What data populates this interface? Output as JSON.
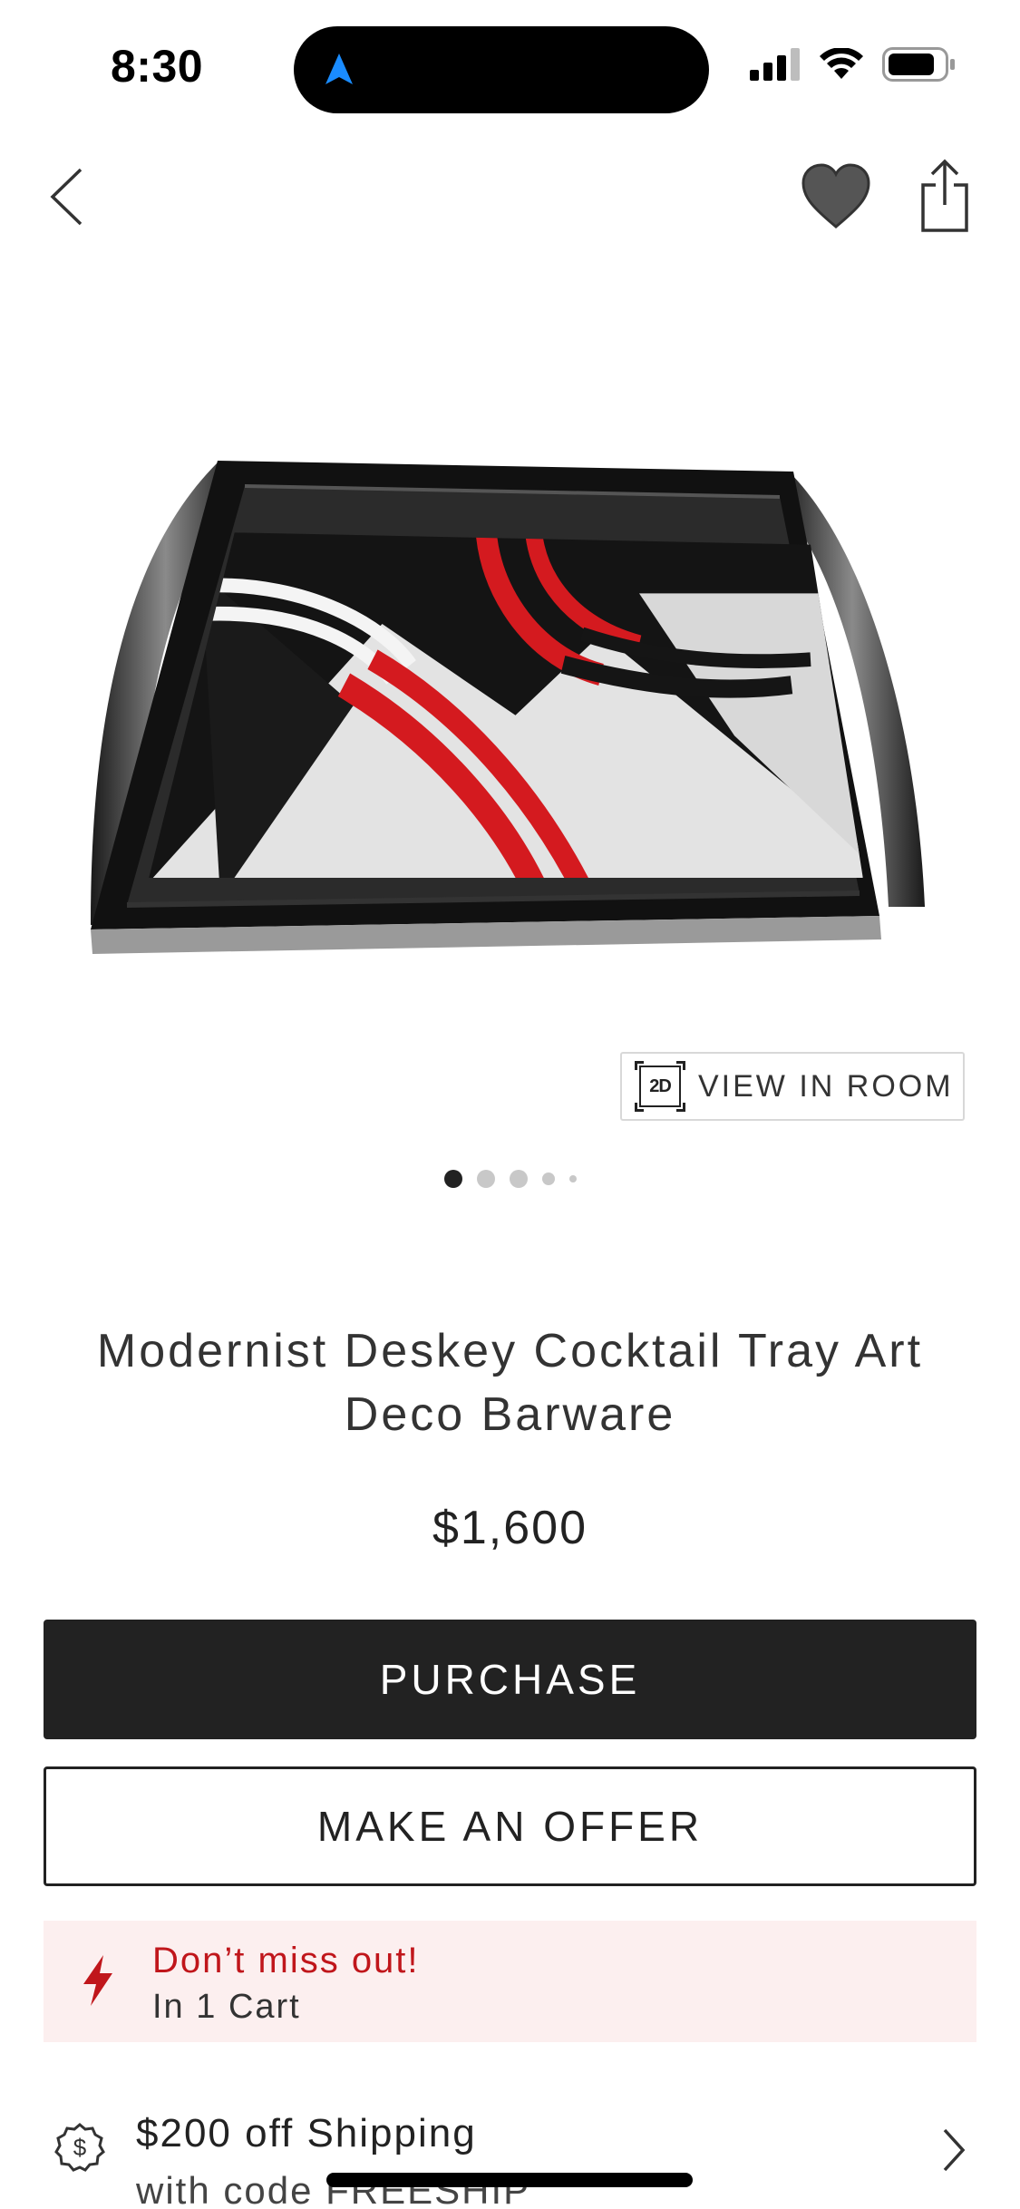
{
  "status_bar": {
    "time": "8:30"
  },
  "product": {
    "title": "Modernist Deskey Cocktail Tray Art Deco Barware",
    "price": "$1,600",
    "image_alt": "Art deco cocktail tray with black, white and red geometric design"
  },
  "view_in_room": {
    "badge": "2D",
    "label": "VIEW IN ROOM"
  },
  "carousel": {
    "total_dots": 5,
    "active_index": 0
  },
  "actions": {
    "purchase_label": "PURCHASE",
    "offer_label": "MAKE AN OFFER"
  },
  "alert": {
    "title": "Don’t miss out!",
    "subtitle": "In 1 Cart"
  },
  "promo": {
    "title": "$200 off Shipping",
    "subtitle": "with code FREESHIP"
  },
  "colors": {
    "accent_red": "#c0161b",
    "alert_bg": "#fcefef",
    "button_dark": "#222222",
    "location_blue": "#1a8cff"
  },
  "icons": {
    "back": "chevron-left-icon",
    "favorite": "heart-icon",
    "share": "share-icon",
    "alert": "lightning-icon",
    "promo": "dollar-badge-icon",
    "promo_chevron": "chevron-right-icon"
  }
}
